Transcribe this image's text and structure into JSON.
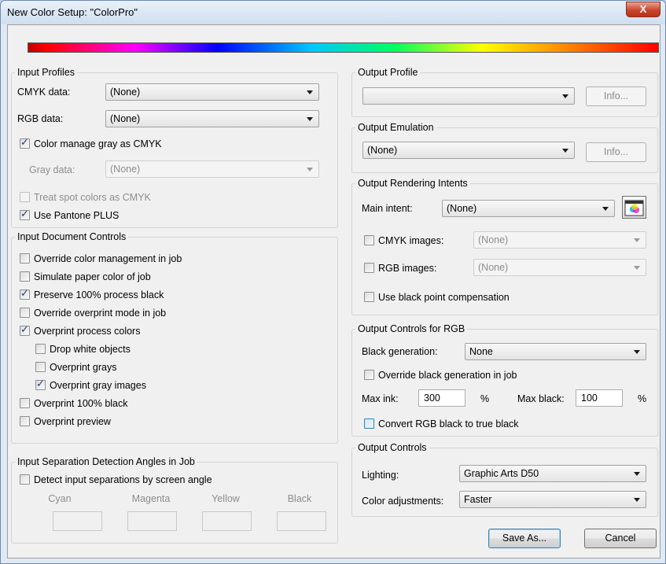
{
  "window": {
    "title": "New Color Setup: \"ColorPro\"",
    "close_label": "X"
  },
  "input_profiles": {
    "title": "Input Profiles",
    "cmyk_label": "CMYK data:",
    "cmyk_value": "(None)",
    "rgb_label": "RGB data:",
    "rgb_value": "(None)",
    "gray_manage_label": "Color manage gray as CMYK",
    "gray_label": "Gray data:",
    "gray_value": "(None)",
    "spot_label": "Treat spot colors as CMYK",
    "pantone_label": "Use Pantone PLUS"
  },
  "input_doc_controls": {
    "title": "Input Document Controls",
    "items": [
      "Override color management in job",
      "Simulate paper color of job",
      "Preserve 100% process black",
      "Override overprint mode in job",
      "Overprint process colors",
      "Drop white objects",
      "Overprint grays",
      "Overprint gray images",
      "Overprint 100% black",
      "Overprint preview"
    ]
  },
  "separation": {
    "title": "Input Separation Detection Angles in Job",
    "detect_label": "Detect input separations by screen angle",
    "cyan": "Cyan",
    "magenta": "Magenta",
    "yellow": "Yellow",
    "black": "Black"
  },
  "output_profile": {
    "title": "Output Profile",
    "value": "",
    "info_label": "Info..."
  },
  "output_emulation": {
    "title": "Output Emulation",
    "value": "(None)",
    "info_label": "Info..."
  },
  "rendering": {
    "title": "Output Rendering Intents",
    "main_label": "Main intent:",
    "main_value": "(None)",
    "cmyk_label": "CMYK images:",
    "cmyk_value": "(None)",
    "rgb_label": "RGB images:",
    "rgb_value": "(None)",
    "bpc_label": "Use black point compensation"
  },
  "rgb_controls": {
    "title": "Output Controls for RGB",
    "bg_label": "Black generation:",
    "bg_value": "None",
    "override_label": "Override black generation in job",
    "maxink_label": "Max ink:",
    "maxink_value": "300",
    "pct1": "%",
    "maxblack_label": "Max black:",
    "maxblack_value": "100",
    "pct2": "%",
    "convert_label": "Convert RGB black to true black"
  },
  "output_controls": {
    "title": "Output Controls",
    "lighting_label": "Lighting:",
    "lighting_value": "Graphic Arts D50",
    "adjust_label": "Color adjustments:",
    "adjust_value": "Faster"
  },
  "footer": {
    "save_as": "Save As...",
    "cancel": "Cancel"
  }
}
